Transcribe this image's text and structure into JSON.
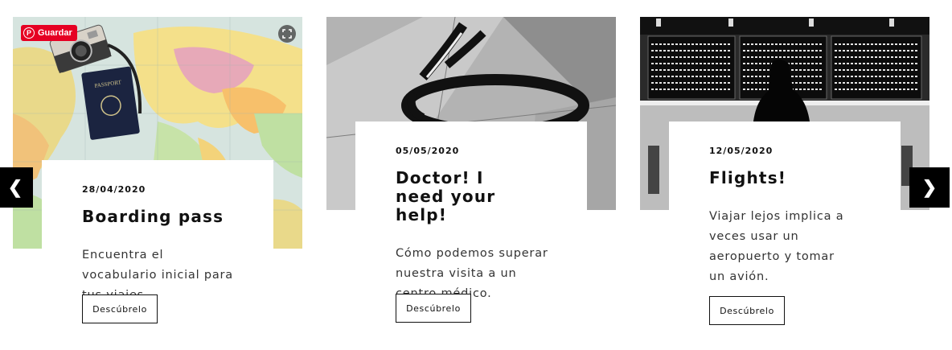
{
  "carousel": {
    "prev_label": "❮",
    "next_label": "❯"
  },
  "pinterest": {
    "save_label": "Guardar",
    "logo_glyph": "P"
  },
  "cards": [
    {
      "date": "28/04/2020",
      "title": "Boarding pass",
      "description": "Encuentra el vocabulario inicial para tus viajes.",
      "button": "Descúbrelo",
      "image": "world-map-passport-camera"
    },
    {
      "date": "05/05/2020",
      "title": "Doctor! I need your help!",
      "description": "Cómo podemos superar nuestra visita a un centro médico.",
      "button": "Descúbrelo",
      "image": "stethoscope-bw"
    },
    {
      "date": "12/05/2020",
      "title": "Flights!",
      "description": "Viajar lejos implica a veces usar un aeropuerto y tomar un avión.",
      "button": "Descúbrelo",
      "image": "airport-departures-board-bw"
    }
  ],
  "colors": {
    "pinterest_red": "#e60023",
    "arrow_bg": "#000000"
  }
}
